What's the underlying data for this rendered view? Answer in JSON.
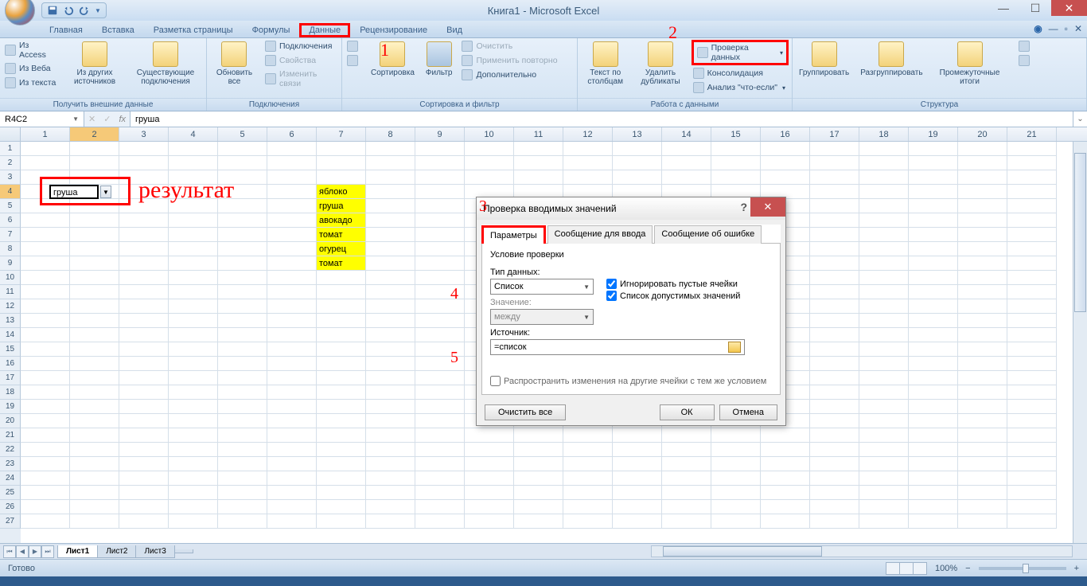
{
  "app": {
    "title": "Книга1 - Microsoft Excel"
  },
  "tabs": {
    "items": [
      "Главная",
      "Вставка",
      "Разметка страницы",
      "Формулы",
      "Данные",
      "Рецензирование",
      "Вид"
    ],
    "active": 4,
    "highlighted": 4
  },
  "ribbon": {
    "groups": {
      "external": {
        "label": "Получить внешние данные",
        "access": "Из Access",
        "web": "Из Веба",
        "text": "Из текста",
        "other": "Из других источников",
        "existing": "Существующие подключения"
      },
      "connections": {
        "label": "Подключения",
        "refresh": "Обновить все",
        "conn": "Подключения",
        "props": "Свойства",
        "links": "Изменить связи"
      },
      "sort": {
        "label": "Сортировка и фильтр",
        "az": "А↓Я",
        "za": "Я↓А",
        "sort_btn": "Сортировка",
        "filter": "Фильтр",
        "clear": "Очистить",
        "reapply": "Применить повторно",
        "advanced": "Дополнительно"
      },
      "data_tools": {
        "label": "Работа с данными",
        "ttc": "Текст по столбцам",
        "dup": "Удалить дубликаты",
        "validation": "Проверка данных",
        "consolidate": "Консолидация",
        "whatif": "Анализ \"что-если\""
      },
      "outline": {
        "label": "Структура",
        "group": "Группировать",
        "ungroup": "Разгруппировать",
        "subtotal": "Промежуточные итоги"
      }
    }
  },
  "formula_bar": {
    "name_box": "R4C2",
    "formula": "груша",
    "fx": "fx"
  },
  "grid": {
    "col_count": 21,
    "row_count": 27,
    "active": {
      "row": 4,
      "col": 2,
      "value": "груша"
    },
    "yellow_list": [
      "яблоко",
      "груша",
      "авокадо",
      "томат",
      "огурец",
      "томат"
    ]
  },
  "annotations": {
    "result": "результат",
    "n1": "1",
    "n2": "2",
    "n3": "3",
    "n4": "4",
    "n5": "5"
  },
  "dialog": {
    "title": "Проверка вводимых значений",
    "tabs": [
      "Параметры",
      "Сообщение для ввода",
      "Сообщение об ошибке"
    ],
    "section": "Условие проверки",
    "type_label": "Тип данных:",
    "type_value": "Список",
    "value_label": "Значение:",
    "value_value": "между",
    "ignore_blank": "Игнорировать пустые ячейки",
    "dropdown_list": "Список допустимых значений",
    "source_label": "Источник:",
    "source_value": "=список",
    "propagate": "Распространить изменения на другие ячейки с тем же условием",
    "clear_all": "Очистить все",
    "ok": "ОК",
    "cancel": "Отмена"
  },
  "sheets": {
    "items": [
      "Лист1",
      "Лист2",
      "Лист3"
    ],
    "active": 0
  },
  "status": {
    "ready": "Готово",
    "zoom": "100%"
  }
}
